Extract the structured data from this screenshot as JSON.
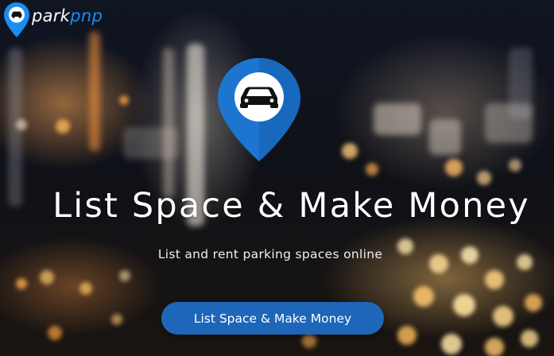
{
  "brand": {
    "name_part1": "park",
    "name_part2": "pnp",
    "primary_color": "#1a8df0",
    "button_color": "#1d66b9"
  },
  "hero": {
    "headline": "List Space & Make Money",
    "subheadline": "List and rent parking spaces online",
    "cta_label": "List Space & Make Money",
    "background": "blurred city night lights"
  },
  "icons": {
    "logo": "map-pin-car-icon",
    "center": "map-pin-car-icon"
  }
}
